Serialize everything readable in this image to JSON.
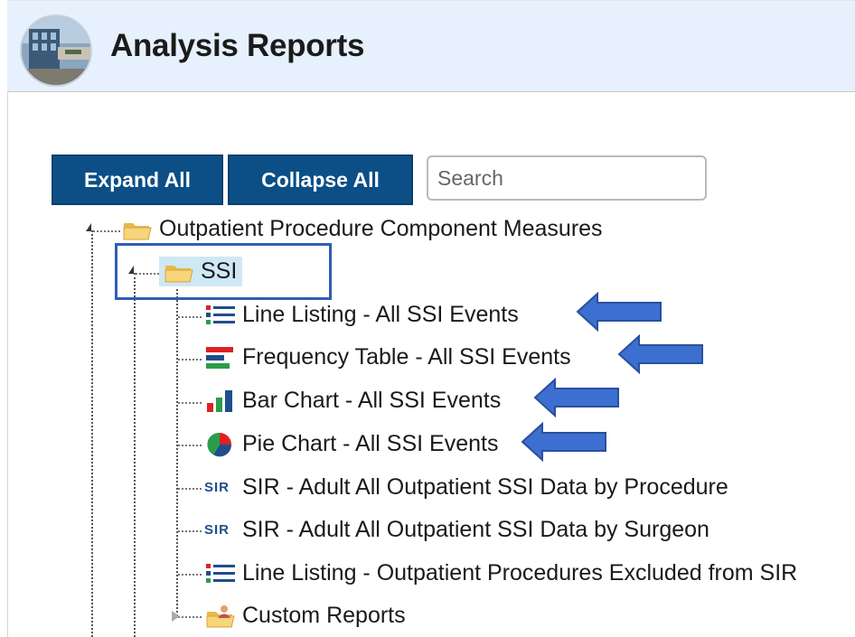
{
  "header": {
    "title": "Analysis Reports"
  },
  "toolbar": {
    "expand_label": "Expand All",
    "collapse_label": "Collapse All",
    "search_placeholder": "Search"
  },
  "tree": {
    "root": {
      "label": "Outpatient Procedure Component Measures",
      "icon": "folder-open-icon"
    },
    "folder": {
      "label": "SSI",
      "icon": "folder-open-icon",
      "highlighted": true
    },
    "items": [
      {
        "label": "Line Listing - All SSI Events",
        "icon": "line-listing-icon",
        "arrow": true
      },
      {
        "label": "Frequency Table - All SSI Events",
        "icon": "frequency-table-icon",
        "arrow": true
      },
      {
        "label": "Bar Chart - All SSI Events",
        "icon": "bar-chart-icon",
        "arrow": true
      },
      {
        "label": "Pie Chart - All SSI Events",
        "icon": "pie-chart-icon",
        "arrow": true
      },
      {
        "label": "SIR - Adult All Outpatient SSI Data by Procedure",
        "icon": "sir-icon",
        "icon_text": "SIR"
      },
      {
        "label": "SIR - Adult All Outpatient SSI Data by Surgeon",
        "icon": "sir-icon",
        "icon_text": "SIR"
      },
      {
        "label": "Line Listing - Outpatient Procedures Excluded from SIR",
        "icon": "line-listing-icon"
      },
      {
        "label": "Custom Reports",
        "icon": "custom-reports-folder-icon"
      }
    ]
  },
  "colors": {
    "button": "#0c4f86",
    "header_bg": "#e6f1fd",
    "highlight_box": "#2f5dba",
    "arrow": "#3d6fd0",
    "selected_bg": "#cfe8f6"
  }
}
